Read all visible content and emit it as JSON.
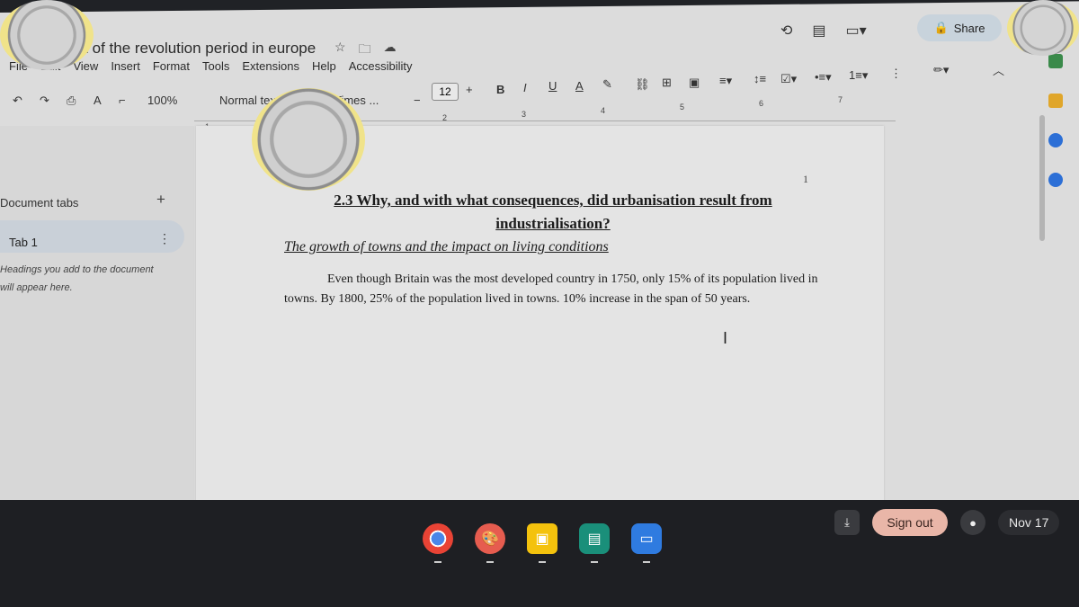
{
  "doc": {
    "title": "the concept of the revolution period in europe",
    "menu": [
      "File",
      "Edit",
      "View",
      "Insert",
      "Format",
      "Tools",
      "Extensions",
      "Help",
      "Accessibility"
    ],
    "zoom": "100%",
    "style": "Normal text",
    "font": "Times ...",
    "font_size": "12",
    "share_label": "Share",
    "page_number": "1",
    "heading": "2.3 Why, and with what consequences, did urbanisation result from industrialisation?",
    "subheading": "The growth of towns and the impact on living conditions",
    "body": "Even though Britain was the most developed country in 1750, only 15% of its population lived in towns. By 1800, 25% of the population lived in towns. 10% increase in the span of 50 years."
  },
  "ruler_numbers": [
    "1",
    "2",
    "3",
    "4",
    "5",
    "6",
    "7"
  ],
  "sidebar": {
    "header": "Document tabs",
    "tab_label": "Tab 1",
    "hint": "Headings you add to the document will appear here."
  },
  "taskbar": {
    "apps": [
      "chrome-icon",
      "canvas-icon",
      "classroom-icon",
      "slides-icon",
      "files-icon"
    ],
    "sign_out": "Sign out",
    "date": "Nov 17"
  }
}
